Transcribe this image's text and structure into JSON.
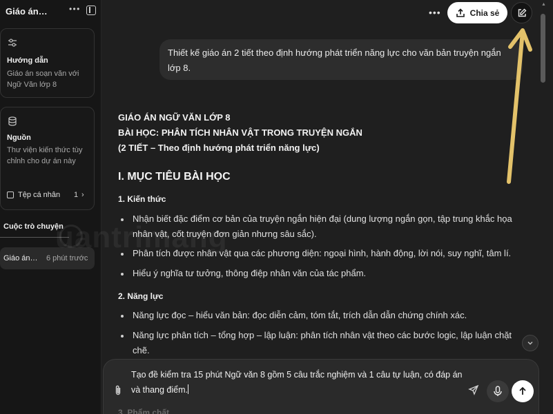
{
  "sidebar": {
    "title": "Giáo án…",
    "guide_card": {
      "heading": "Hướng dẫn",
      "text": "Giáo án soạn văn với Ngữ Văn lớp 8"
    },
    "source_card": {
      "heading": "Nguồn",
      "text": "Thư viện kiến thức tùy chỉnh cho dự án này",
      "files_label": "Tệp cá nhân",
      "files_count": "1"
    },
    "conversations_label": "Cuộc trò chuyện",
    "conversation": {
      "title": "Giáo án…",
      "time": "6 phút trước"
    }
  },
  "topbar": {
    "share_label": "Chia sẻ"
  },
  "user_message": "Thiết kế giáo án 2 tiết theo định hướng phát triển năng lực cho văn bản truyện ngắn lớp 8.",
  "response": {
    "title_lines": [
      "GIÁO ÁN NGỮ VĂN LỚP 8",
      "BÀI HỌC: PHÂN TÍCH NHÂN VẬT TRONG TRUYỆN NGẮN",
      "(2 TIẾT – Theo định hướng phát triển năng lực)"
    ],
    "section1": "I. MỤC TIÊU BÀI HỌC",
    "sub1": "1. Kiến thức",
    "sub1_items": [
      "Nhận biết đặc điểm cơ bản của truyện ngắn hiện đại (dung lượng ngắn gọn, tập trung khắc họa nhân vật, cốt truyện đơn giản nhưng sâu sắc).",
      "Phân tích được nhân vật qua các phương diện: ngoại hình, hành động, lời nói, suy nghĩ, tâm lí.",
      "Hiểu ý nghĩa tư tưởng, thông điệp nhân văn của tác phẩm."
    ],
    "sub2": "2. Năng lực",
    "sub2_items": [
      "Năng lực đọc – hiểu văn bản: đọc diễn cảm, tóm tắt, trích dẫn dẫn chứng chính xác.",
      "Năng lực phân tích – tổng hợp – lập luận: phân tích nhân vật theo các bước logic, lập luận chặt chẽ."
    ],
    "sub3_peek": "3. Phẩm chất"
  },
  "composer": {
    "text": "Tạo đề kiểm tra 15 phút Ngữ văn 8 gồm 5 câu trắc nghiệm và 1 câu tự luận, có đáp án và thang điểm."
  },
  "watermark": "uantrimang",
  "colors": {
    "annotation_arrow": "#e3c26a",
    "background": "#1f1f1f",
    "sidebar": "#161616"
  }
}
